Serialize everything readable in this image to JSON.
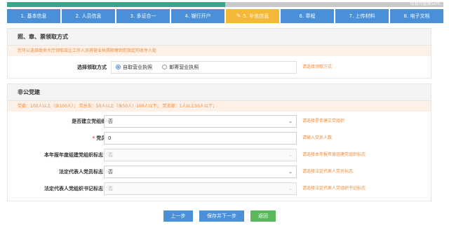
{
  "progress": {
    "label": "信息完整度50%",
    "fraction": 0.5
  },
  "steps": [
    {
      "label": "1. 基本信息"
    },
    {
      "label": "2. 人员信息"
    },
    {
      "label": "3. 多证合一"
    },
    {
      "label": "4. 银行开户"
    },
    {
      "label": "5. 补充信息"
    },
    {
      "label": "6. 章程"
    },
    {
      "label": "7. 上传材料"
    },
    {
      "label": "8. 电子文档"
    }
  ],
  "active_step": 4,
  "pickup_section": {
    "title": "照、章、票领取方式",
    "notice": "您可以选择政务大厅领取或让工作人员将营业执照邮寄到您指定的收件人处",
    "method_label": "选择领取方式",
    "options": [
      "自取营业执照",
      "邮寄营业执照"
    ],
    "selected_index": 0,
    "hint": "请选择领取方式"
  },
  "party_section": {
    "title": "非公党建",
    "notice": "党委：100人以上（含100人）；   党总支：50人以上（含50人）100人以下；   党支部：1人以上50人以下；",
    "fields": [
      {
        "label": "是否建立党组织:",
        "value": "否",
        "hint": "请选择是否建立党组织",
        "type": "select",
        "disabled": false,
        "required": false
      },
      {
        "label": "党员:",
        "value": "0",
        "hint": "请输入党员人数",
        "type": "input",
        "disabled": false,
        "required": true
      },
      {
        "label": "本年报年度组建党组织标志：",
        "value": "否",
        "hint": "请选择本年报年度组建党组织标志",
        "type": "select",
        "disabled": true,
        "required": false
      },
      {
        "label": "法定代表人党员标志：",
        "value": "否",
        "hint": "请选择法定代表人党员标志",
        "type": "select",
        "disabled": false,
        "required": false
      },
      {
        "label": "法定代表人党组织书记标志：",
        "value": "否",
        "hint": "请选择法定代表人党组织书记标志",
        "type": "select",
        "disabled": true,
        "required": false
      }
    ]
  },
  "buttons": {
    "prev": "上一步",
    "save_next": "保存并下一步",
    "back": "返回"
  },
  "colors": {
    "tab_blue": "#4a90d9",
    "tab_active": "#f5b83b",
    "progress_green": "#3aa58a",
    "hint_orange": "#f08a3c",
    "back_green": "#5cb85c"
  },
  "icons": {
    "active_step": "pencil-icon",
    "select": "chevron-down-icon"
  }
}
